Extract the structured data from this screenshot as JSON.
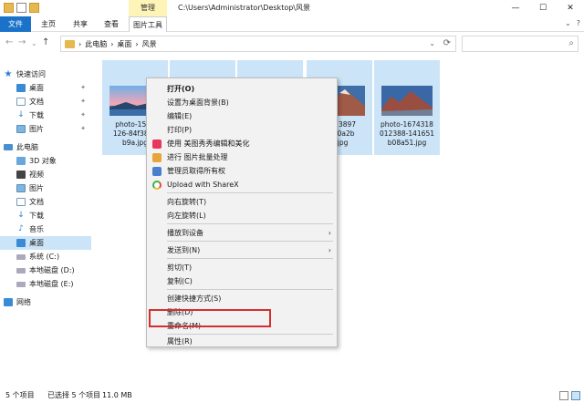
{
  "titlebar": {
    "manage": "管理",
    "path": "C:\\Users\\Administrator\\Desktop\\风景",
    "minimize": "—",
    "maximize": "☐",
    "close": "✕"
  },
  "ribbon": {
    "tabs": [
      "文件",
      "主页",
      "共享",
      "查看",
      "图片工具"
    ],
    "right_chevron": "⌄",
    "help": "?"
  },
  "address": {
    "back": "←",
    "forward": "→",
    "dropdown": "⌄",
    "up": "↑",
    "crumbs": [
      "此电脑",
      "桌面",
      "风景"
    ],
    "separator": "›",
    "search_placeholder": ""
  },
  "sidebar": {
    "items": [
      {
        "label": "快速访问"
      },
      {
        "label": "桌面"
      },
      {
        "label": "文档"
      },
      {
        "label": "下载"
      },
      {
        "label": "图片"
      },
      {
        "label": "此电脑"
      },
      {
        "label": "3D 对象"
      },
      {
        "label": "视频"
      },
      {
        "label": "图片"
      },
      {
        "label": "文档"
      },
      {
        "label": "下载"
      },
      {
        "label": "音乐"
      },
      {
        "label": "桌面"
      },
      {
        "label": "系统 (C:)"
      },
      {
        "label": "本地磁盘 (D:)"
      },
      {
        "label": "本地磁盘 (E:)"
      },
      {
        "label": "网络"
      }
    ]
  },
  "files": [
    {
      "name": "photo-1559\n126-84f3897\nb9a.jpg"
    },
    {
      "name": ""
    },
    {
      "name": ""
    },
    {
      "name": "-1673897\n73a0a2b\n5.jpg"
    },
    {
      "name": "photo-1674318\n012388-141651\nb08a51.jpg"
    }
  ],
  "context_menu": {
    "items": [
      "打开(O)",
      "设置为桌面背景(B)",
      "编辑(E)",
      "打印(P)",
      "使用 美图秀秀编辑和美化",
      "进行 图片批量处理",
      "管理员取得所有权",
      "Upload with ShareX",
      "向右旋转(T)",
      "向左旋转(L)",
      "播放到设备",
      "发送到(N)",
      "剪切(T)",
      "复制(C)",
      "创建快捷方式(S)",
      "删除(D)",
      "重命名(M)",
      "属性(R)"
    ],
    "submenu_arrow": "›"
  },
  "statusbar": {
    "count": "5 个项目",
    "selected": "已选择 5 个项目",
    "size": "11.0 MB"
  },
  "colors": {
    "accent": "#1a73c8",
    "selection": "#cce4f7",
    "highlight_box": "#d32f2f"
  }
}
